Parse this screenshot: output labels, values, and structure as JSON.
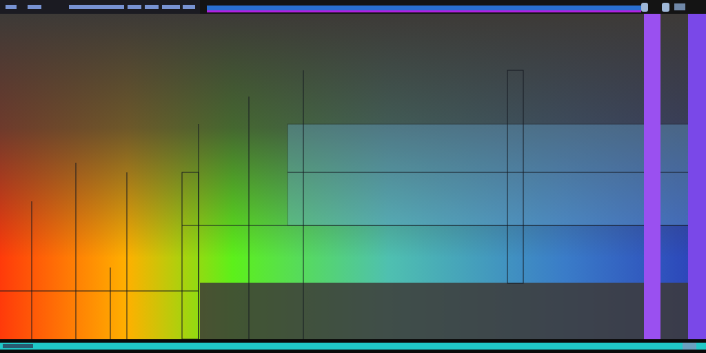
{
  "header": {
    "kind": "scribbles"
  },
  "canvas": {
    "kind": "gradient-blocks"
  },
  "footer": {
    "kind": "scribbles"
  }
}
